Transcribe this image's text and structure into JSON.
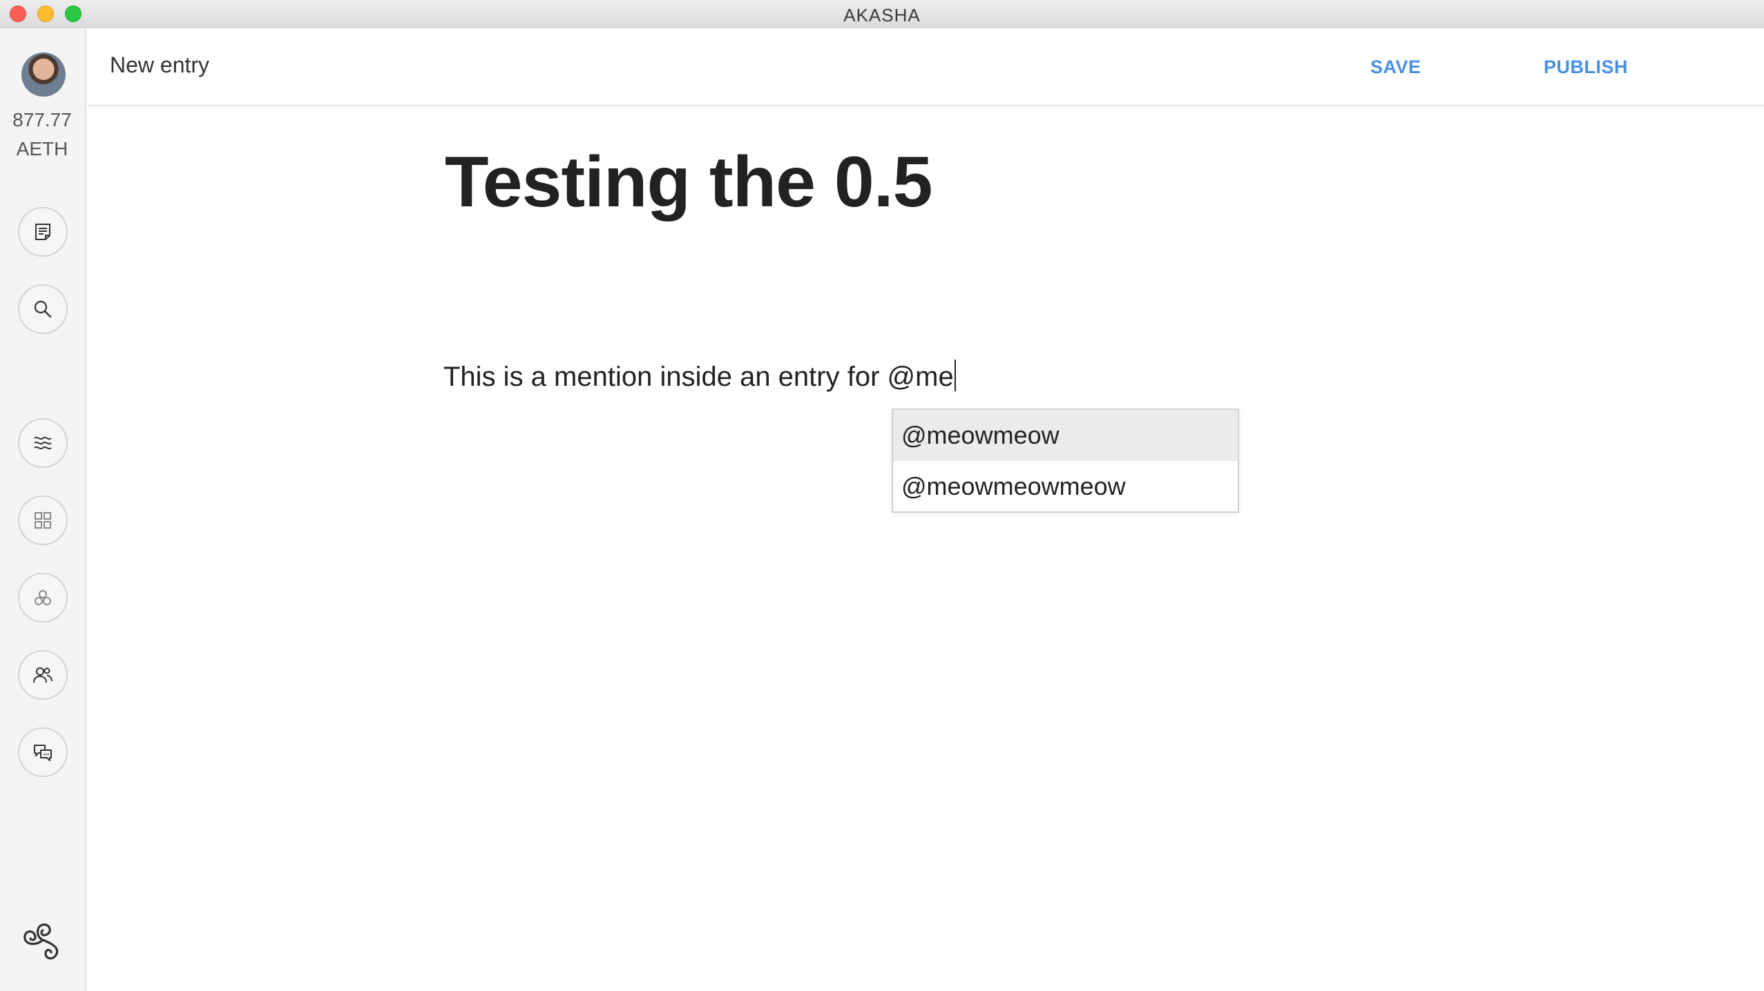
{
  "window": {
    "app_title": "AKASHA"
  },
  "sidebar": {
    "balance_amount": "877.77",
    "balance_unit": "AETH",
    "buttons": [
      {
        "icon": "entry-icon"
      },
      {
        "icon": "search-icon"
      },
      {
        "icon": "stream-icon"
      },
      {
        "icon": "grid-icon"
      },
      {
        "icon": "communities-icon"
      },
      {
        "icon": "people-icon"
      },
      {
        "icon": "chat-icon"
      }
    ],
    "logo": "akasha-logo"
  },
  "header": {
    "title": "New entry",
    "save_label": "SAVE",
    "publish_label": "PUBLISH",
    "accent_color": "#4a90e2"
  },
  "editor": {
    "title": "Testing the 0.5",
    "body_text": "This is a mention inside an entry for @me"
  },
  "mention_suggestions": [
    {
      "label": "@meowmeow",
      "highlighted": true
    },
    {
      "label": "@meowmeowmeow",
      "highlighted": false
    }
  ]
}
